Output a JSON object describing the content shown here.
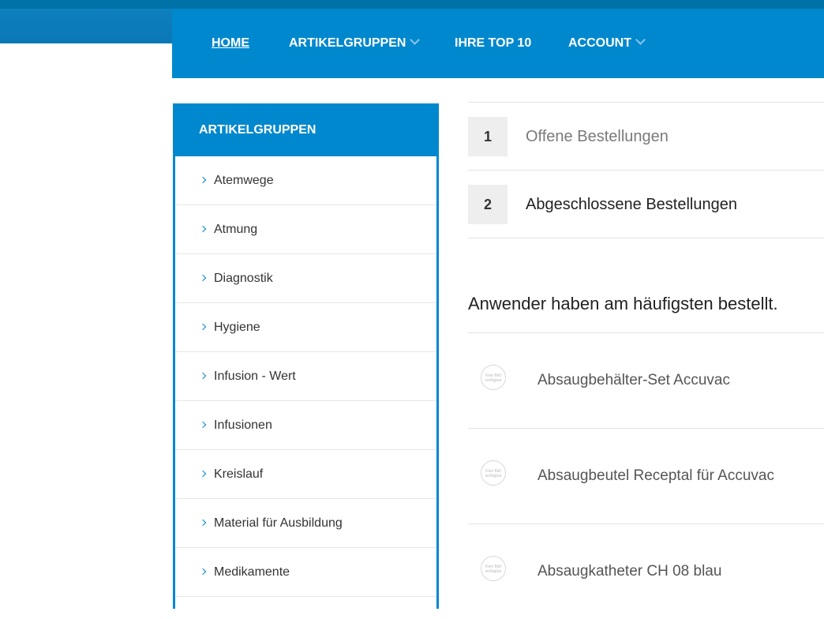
{
  "nav": {
    "items": [
      {
        "label": "HOME",
        "active": true,
        "dropdown": false
      },
      {
        "label": "ARTIKELGRUPPEN",
        "active": false,
        "dropdown": true
      },
      {
        "label": "IHRE TOP 10",
        "active": false,
        "dropdown": false
      },
      {
        "label": "ACCOUNT",
        "active": false,
        "dropdown": true
      }
    ]
  },
  "sidebar": {
    "title": "ARTIKELGRUPPEN",
    "items": [
      {
        "label": "Atemwege"
      },
      {
        "label": "Atmung"
      },
      {
        "label": "Diagnostik"
      },
      {
        "label": "Hygiene"
      },
      {
        "label": "Infusion - Wert"
      },
      {
        "label": "Infusionen"
      },
      {
        "label": "Kreislauf"
      },
      {
        "label": "Material für Ausbildung"
      },
      {
        "label": "Medikamente"
      }
    ]
  },
  "orders": {
    "steps": [
      {
        "num": "1",
        "label": "Offene Bestellungen"
      },
      {
        "num": "2",
        "label": "Abgeschlossene Bestellungen"
      }
    ]
  },
  "top_products": {
    "title": "Anwender haben am häufigsten bestellt.",
    "placeholder_text": "Kein Bild verfügbar",
    "items": [
      {
        "name": "Absaugbehälter-Set Accuvac"
      },
      {
        "name": "Absaugbeutel Receptal für Accuvac"
      },
      {
        "name": "Absaugkatheter CH 08 blau"
      }
    ]
  },
  "colors": {
    "brand_blue": "#0088ce",
    "top_strip": "#0072a8",
    "step_bg": "#eeeeee"
  }
}
